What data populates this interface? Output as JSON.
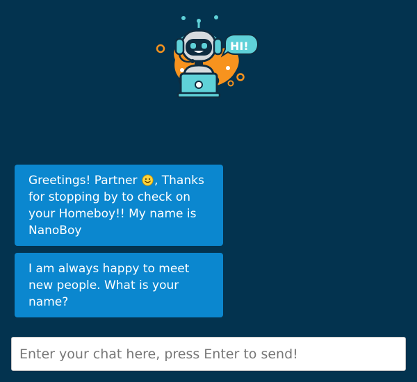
{
  "branding": {
    "logo_icon": "robot-with-laptop-icon",
    "speech_text": "HI!"
  },
  "colors": {
    "background": "#03334f",
    "bubble": "#0b87cf",
    "accent": "#f7931e",
    "teal": "#5fd1d8"
  },
  "messages": [
    {
      "before_emoji": "Greetings! Partner ",
      "emoji": "smiling-face-icon",
      "after_emoji": ", Thanks for stopping by to check on your Homeboy!! My name is NanoBoy"
    },
    {
      "text": "I am always happy to meet new people. What is your name?"
    }
  ],
  "input": {
    "value": "",
    "placeholder": "Enter your chat here, press Enter to send!"
  }
}
